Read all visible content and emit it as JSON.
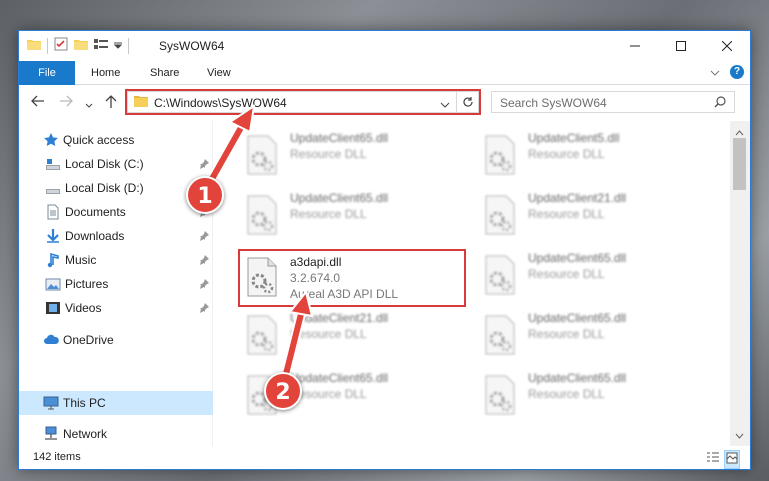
{
  "window": {
    "title": "SysWOW64",
    "minimize_label": "—",
    "maximize_label": "☐",
    "close_label": "✕"
  },
  "ribbon": {
    "tabs": [
      "File",
      "Home",
      "Share",
      "View"
    ]
  },
  "address_bar": {
    "path": "C:\\Windows\\SysWOW64"
  },
  "search": {
    "placeholder": "Search SysWOW64"
  },
  "sidebar": {
    "items": [
      {
        "label": "Quick access",
        "icon": "star-icon",
        "pinned": false
      },
      {
        "label": "Local Disk (C:)",
        "icon": "drive-icon",
        "pinned": true
      },
      {
        "label": "Local Disk (D:)",
        "icon": "drive-icon",
        "pinned": true
      },
      {
        "label": "Documents",
        "icon": "documents-icon",
        "pinned": true
      },
      {
        "label": "Downloads",
        "icon": "download-icon",
        "pinned": true
      },
      {
        "label": "Music",
        "icon": "music-icon",
        "pinned": true
      },
      {
        "label": "Pictures",
        "icon": "pictures-icon",
        "pinned": true
      },
      {
        "label": "Videos",
        "icon": "videos-icon",
        "pinned": true
      },
      {
        "label": "OneDrive",
        "icon": "cloud-icon",
        "pinned": false
      },
      {
        "label": "This PC",
        "icon": "computer-icon",
        "pinned": false,
        "selected": true
      },
      {
        "label": "Network",
        "icon": "network-icon",
        "pinned": false
      }
    ]
  },
  "files": [
    {
      "name": "UpdateClient65.dll",
      "desc": "Resource DLL",
      "blurred": true
    },
    {
      "name": "UpdateClient5.dll",
      "desc": "Resource DLL",
      "blurred": true
    },
    {
      "name": "UpdateClient65.dll",
      "desc": "Resource DLL",
      "blurred": true
    },
    {
      "name": "UpdateClient21.dll",
      "desc": "Resource DLL",
      "blurred": true
    },
    {
      "name": "a3dapi.dll",
      "version": "3.2.674.0",
      "desc": "Aureal A3D API DLL",
      "blurred": false
    },
    {
      "name": "UpdateClient65.dll",
      "desc": "Resource DLL",
      "blurred": true
    },
    {
      "name": "UpdateClient21.dll",
      "desc": "Resource DLL",
      "blurred": true
    },
    {
      "name": "UpdateClient65.dll",
      "desc": "Resource DLL",
      "blurred": true
    },
    {
      "name": "UpdateClient65.dll",
      "desc": "Resource DLL",
      "blurred": true
    },
    {
      "name": "UpdateClient65.dll",
      "desc": "Resource DLL",
      "blurred": true
    }
  ],
  "status": {
    "item_count": "142 items"
  },
  "markers": [
    "1",
    "2"
  ],
  "colors": {
    "accent": "#1979ca",
    "highlight": "#d83a3a",
    "selected": "#cce8ff"
  }
}
